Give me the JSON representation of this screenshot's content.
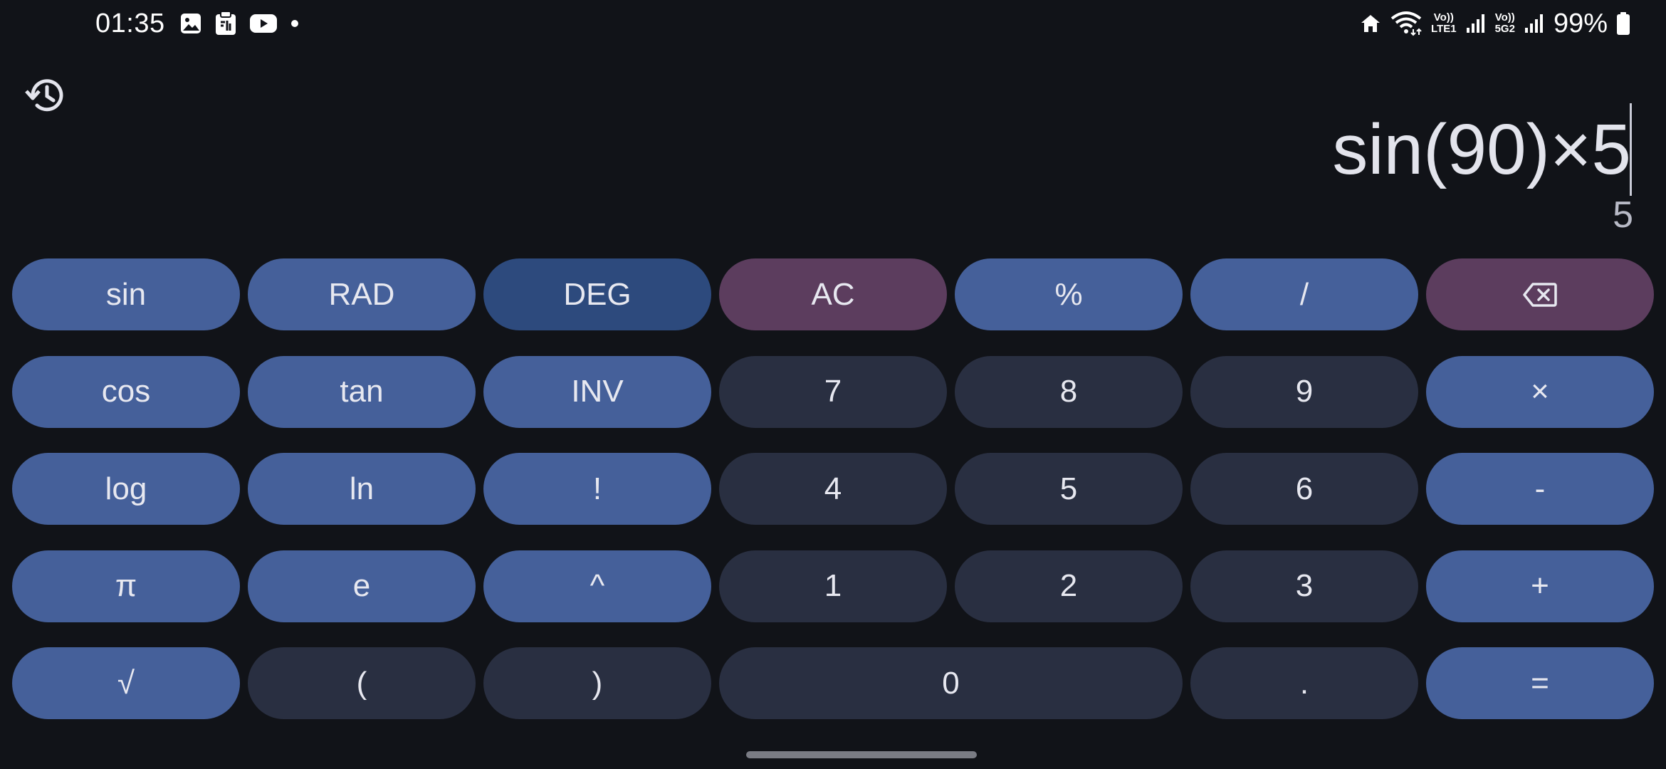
{
  "status_bar": {
    "time": "01:35",
    "left_icons": [
      "gallery-icon",
      "clipboard-icon",
      "youtube-icon",
      "notification-dot-icon"
    ],
    "right_icons": [
      "home-icon",
      "wifi-icon",
      "volte-lte1-icon",
      "signal-icon",
      "volte-5g2-icon",
      "signal-icon"
    ],
    "volte1_top": "Vo))",
    "volte1_bottom": "LTE1",
    "volte2_top": "Vo))",
    "volte2_bottom": "5G2",
    "battery": "99%"
  },
  "display": {
    "expression": "sin(90)×5",
    "result": "5"
  },
  "keypad": {
    "row1": [
      "sin",
      "RAD",
      "DEG",
      "AC",
      "%",
      "/",
      "⌫"
    ],
    "row2": [
      "cos",
      "tan",
      "INV",
      "7",
      "8",
      "9",
      "×"
    ],
    "row3": [
      "log",
      "ln",
      "!",
      "4",
      "5",
      "6",
      "-"
    ],
    "row4": [
      "π",
      "e",
      "^",
      "1",
      "2",
      "3",
      "+"
    ],
    "row5": [
      "√",
      "(",
      ")",
      "0",
      ".",
      "="
    ]
  },
  "colors": {
    "background": "#111318",
    "function_key": "#45609a",
    "selected_mode_key": "#2d4a7d",
    "clear_key": "#5c3d5e",
    "number_key": "#292f41",
    "key_text": "#e7e8f0"
  }
}
